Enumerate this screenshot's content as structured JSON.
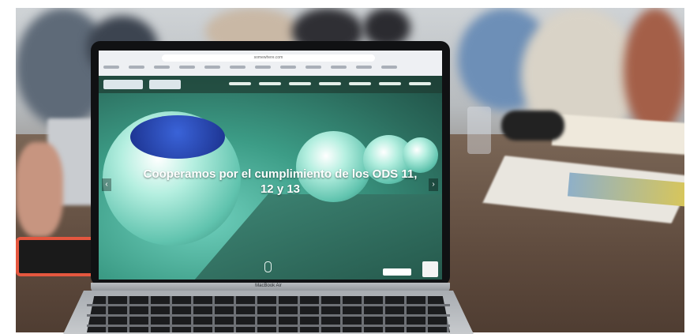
{
  "photo": {
    "description_only_visual": true
  },
  "browser": {
    "url_text": "somewhere.com"
  },
  "site": {
    "headline_line1": "Cooperamos por el cumplimiento de los ODS 11,",
    "headline_line2": "12 y 13",
    "prev_arrow": "‹",
    "next_arrow": "›"
  },
  "laptop": {
    "brand": "MacBook Air"
  },
  "colors": {
    "phone_case": "#e5573f",
    "screen_teal": "#3c9c86",
    "bin_lid_blue": "#3a63d8"
  }
}
